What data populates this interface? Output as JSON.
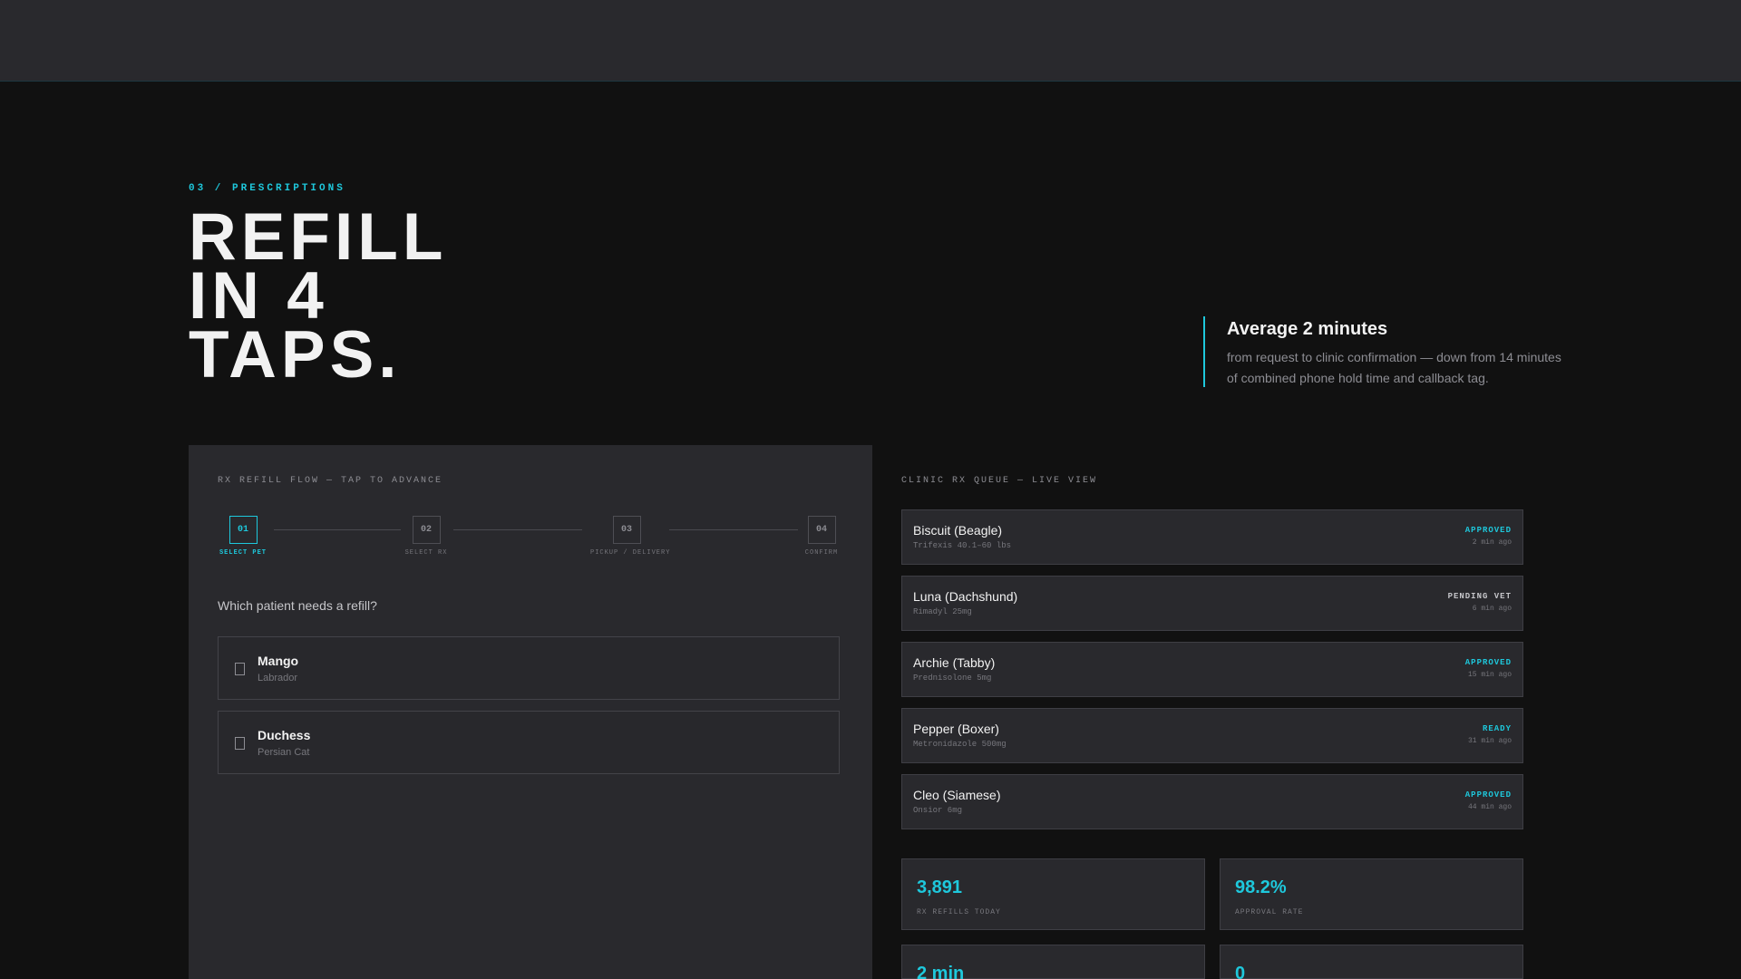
{
  "hero": {
    "eyebrow": "03 / PRESCRIPTIONS",
    "headline": [
      "REFILL",
      "IN 4",
      "TAPS."
    ]
  },
  "stat_callout": {
    "title": "Average 2 minutes",
    "description": "from request to clinic confirmation — down from 14 minutes of combined phone hold time and callback tag."
  },
  "flow": {
    "label": "RX REFILL FLOW — TAP TO ADVANCE",
    "active_step": 1,
    "steps": [
      {
        "num": "01",
        "label": "SELECT PET"
      },
      {
        "num": "02",
        "label": "SELECT RX"
      },
      {
        "num": "03",
        "label": "PICKUP / DELIVERY"
      },
      {
        "num": "04",
        "label": "CONFIRM"
      }
    ],
    "question": "Which patient needs a refill?",
    "pets": [
      {
        "name": "Mango",
        "breed": "Labrador"
      },
      {
        "name": "Duchess",
        "breed": "Persian Cat"
      }
    ]
  },
  "queue": {
    "label": "CLINIC RX QUEUE — LIVE VIEW",
    "items": [
      {
        "name": "Biscuit (Beagle)",
        "drug": "Trifexis 40.1–60 lbs",
        "status": "APPROVED",
        "time": "2 min ago",
        "color": "#1ec8dc"
      },
      {
        "name": "Luna (Dachshund)",
        "drug": "Rimadyl 25mg",
        "status": "PENDING VET",
        "time": "6 min ago",
        "color": "#c6c6ca"
      },
      {
        "name": "Archie (Tabby)",
        "drug": "Prednisolone 5mg",
        "status": "APPROVED",
        "time": "15 min ago",
        "color": "#1ec8dc"
      },
      {
        "name": "Pepper (Boxer)",
        "drug": "Metronidazole 500mg",
        "status": "READY",
        "time": "31 min ago",
        "color": "#1ec8dc"
      },
      {
        "name": "Cleo (Siamese)",
        "drug": "Onsior 6mg",
        "status": "APPROVED",
        "time": "44 min ago",
        "color": "#1ec8dc"
      }
    ]
  },
  "metrics": [
    {
      "value": "3,891",
      "label": "RX REFILLS TODAY"
    },
    {
      "value": "98.2%",
      "label": "APPROVAL RATE"
    },
    {
      "value": "2 min",
      "label": ""
    },
    {
      "value": "0",
      "label": ""
    }
  ],
  "colors": {
    "accent": "#1ec8dc",
    "panel": "#29292d",
    "background": "#111111"
  }
}
